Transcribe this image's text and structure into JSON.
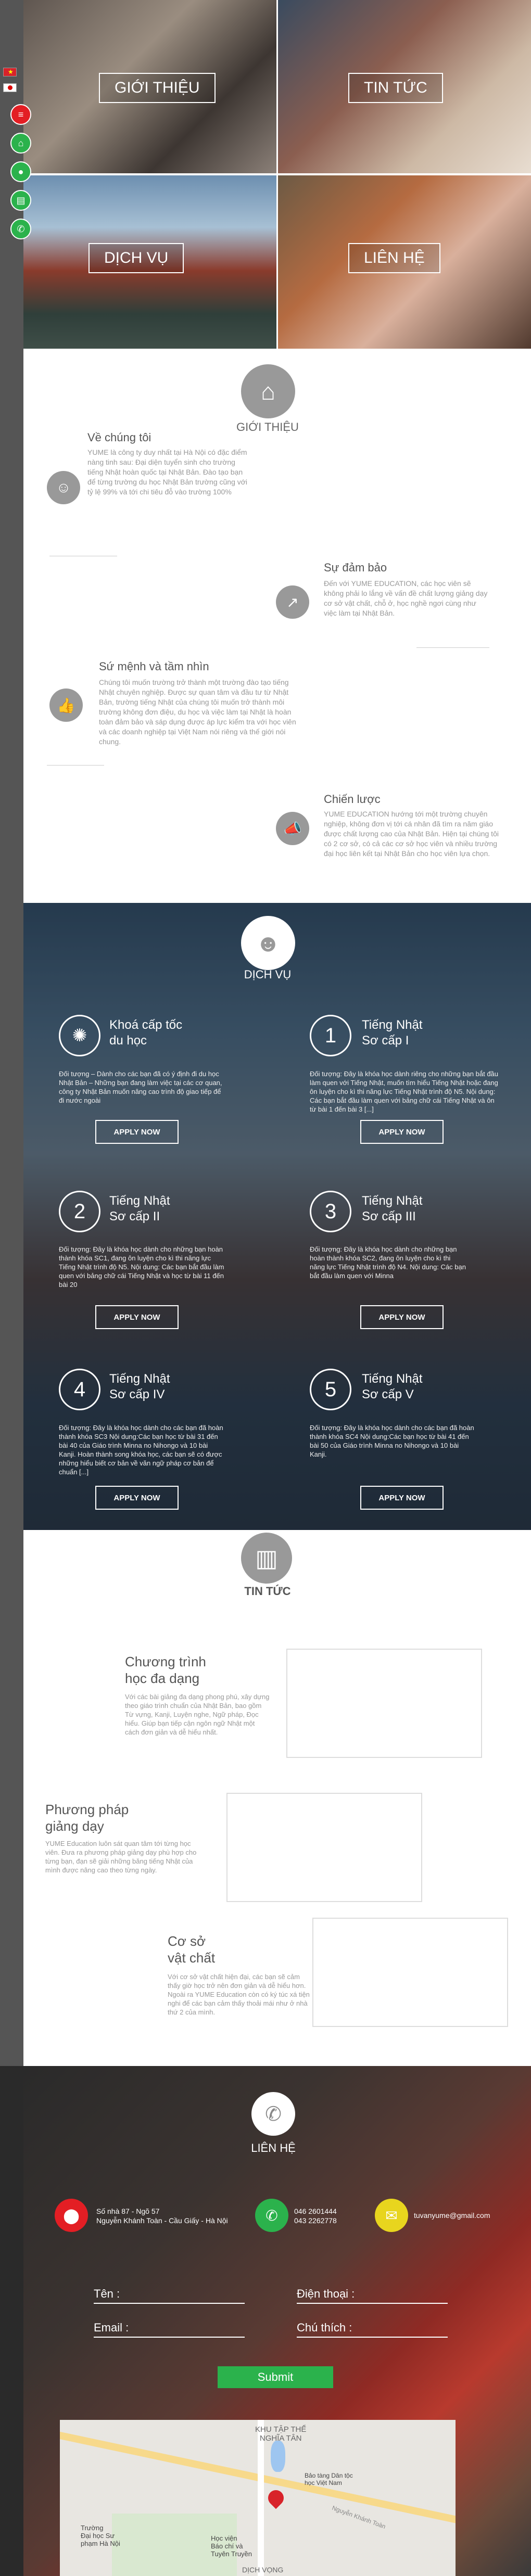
{
  "side": {
    "icons": [
      "menu-icon",
      "home-icon",
      "user-icon",
      "document-icon",
      "phone-icon"
    ]
  },
  "hero": {
    "tiles": [
      "GIỚI THIỆU",
      "TIN TỨC",
      "DỊCH VỤ",
      "LIÊN HỆ"
    ]
  },
  "about": {
    "title": "GIỚI THIỆU",
    "items": [
      {
        "title": "Về chúng tôi",
        "text": "YUME là công ty duy nhất tại Hà Nội có đặc điểm nàng tinh sau: Đại diện tuyển sinh cho trường tiếng Nhật hoàn quốc tại Nhật Bản. Đào tạo bạn để từng trường du học Nhật Bản trường cũng với tỷ lệ 99% và tới chi tiêu đỗ vào trường 100%"
      },
      {
        "title": "Sự đảm bảo",
        "text": "Đến với YUME EDUCATION, các học viên sẽ không phải lo lắng về vấn đề chất lượng giảng dạy cơ sở vật chất, chỗ ở, học nghề ngơi cùng như việc làm tại Nhật Bản."
      },
      {
        "title": "Sứ mệnh và tầm nhìn",
        "text": "Chúng tôi muốn trường trở thành một trường đào tạo tiếng Nhật chuyên nghiệp. Được sự quan tâm và đầu tư từ Nhật Bản, trường tiếng Nhật của chúng tôi muốn trở thành môi trường không đơn điệu, du học và việc làm tại Nhật là hoàn toàn đảm bảo và sáp dụng được áp lực kiểm tra với học viên và các doanh nghiệp tại Việt Nam nói riêng và thế giới nói chung."
      },
      {
        "title": "Chiến lược",
        "text": "YUME EDUCATION hướng tới một trường chuyên nghiệp, không đơn vị tới cá nhân đã tìm ra năm giáo được chất lượng cao của Nhật Bản. Hiện tại chúng tôi có 2 cơ sở, có cả các cơ sở học viên và nhiều trường đại học liên kết tại Nhật Bản cho học viên lựa chọn."
      }
    ]
  },
  "services": {
    "title": "DỊCH VỤ",
    "apply_label": "APPLY NOW",
    "items": [
      {
        "mark": "✺",
        "title1": "Khoá cấp tốc",
        "title2": "du học",
        "text": "Đối tượng – Dành cho các bạn đã có ý định đi du học Nhật Bản – Những bạn đang làm việc tại các cơ quan, công ty Nhật Bản muốn nâng cao trình độ giao tiếp để đi nước ngoài"
      },
      {
        "mark": "1",
        "title1": "Tiếng Nhật",
        "title2": "Sơ cấp I",
        "text": "Đối tượng: Đây là khóa học dành riêng cho những bạn bắt đầu làm quen với Tiếng Nhật, muốn tìm hiểu Tiếng Nhật hoặc đang ôn luyện cho kì thi năng lực Tiếng Nhật trình độ N5. Nội dung: Các bạn bắt đầu làm quen với bảng chữ cái Tiếng Nhật và ôn từ bài 1 đến bài 3 [...]"
      },
      {
        "mark": "2",
        "title1": "Tiếng Nhật",
        "title2": "Sơ cấp II",
        "text": "Đối tượng: Đây là khóa học dành cho những bạn hoàn thành khóa SC1, đang ôn luyện cho kì thi năng lực Tiếng Nhật trình độ N5. Nội dung: Các bạn bắt đầu làm quen với bảng chữ cái Tiếng Nhật và học từ bài 11 đến bài 20"
      },
      {
        "mark": "3",
        "title1": "Tiếng Nhật",
        "title2": "Sơ cấp III",
        "text": "Đối tượng: Đây là khóa học dành cho những bạn hoàn thành khóa SC2, đang ôn luyện cho kì thi năng lực Tiếng Nhật trình độ N4. Nội dung: Các bạn bắt đầu làm quen với Minna"
      },
      {
        "mark": "4",
        "title1": "Tiếng Nhật",
        "title2": "Sơ cấp IV",
        "text": "Đối tượng: Đây là khóa học dành cho các bạn đã hoàn thành khóa SC3 Nội dung:Các bạn học từ bài 31 đến bài 40 của Giáo trình Minna no Nihongo và 10 bài Kanji. Hoàn thành song khóa học, các bạn sẽ có được những hiểu biết cơ bản về văn ngữ pháp cơ bản để chuẩn [...]"
      },
      {
        "mark": "5",
        "title1": "Tiếng Nhật",
        "title2": "Sơ cấp V",
        "text": "Đối tượng: Đây là khóa học dành cho các bạn đã hoàn thành khóa SC4 Nội dung:Các bạn học từ bài 41 đến bài 50 của Giáo trình Minna no Nihongo và 10 bài Kanji."
      }
    ]
  },
  "news": {
    "title": "TIN TỨC",
    "items": [
      {
        "title1": "Chương trình",
        "title2": "học đa dạng",
        "text": "Với các bài giảng đa dạng phong phú, xây dựng theo giáo trình chuẩn của Nhật Bản, bao gồm Từ vựng, Kanji, Luyện nghe, Ngữ pháp, Đọc hiểu. Giúp bạn tiếp cận ngôn ngữ Nhật một cách đơn giản và dễ hiểu nhất."
      },
      {
        "title1": "Phương pháp",
        "title2": "giảng dạy",
        "text": "YUME Education luôn sát quan tâm tới từng học viên. Đưa ra phương pháp giảng dạy phù hợp cho từng bạn, đạn sẽ giải những băng tiếng Nhật của mình được nâng cao theo từng ngày."
      },
      {
        "title1": "Cơ sở",
        "title2": "vật chất",
        "text": "Với cơ sở vật chất hiện đại, các bạn sẽ cảm thấy giờ học trở nên đơn giản và dễ hiểu hơn. Ngoài ra YUME Education còn có ký túc xá tiện nghi để các bạn cảm thấy thoải mái như ở nhà thứ 2 của mình."
      }
    ]
  },
  "contact": {
    "title": "LIÊN HỆ",
    "address": [
      "Số nhà 87 - Ngõ 57",
      "Nguyễn Khánh Toàn - Cầu Giấy - Hà Nội"
    ],
    "phones": [
      "046 2601444",
      "043 2262778"
    ],
    "email": "tuvanyume@gmail.com",
    "labels": {
      "name": "Tên :",
      "phone": "Điện thoại :",
      "email": "Email :",
      "note": "Chú thích :"
    },
    "submit": "Submit",
    "map_labels": [
      "KHU TẬP THỂ",
      "NGHĨA TÂN",
      "Bảo tàng Dân tộc",
      "học Việt Nam",
      "Trường",
      "Đại học Sư",
      "phạm Hà Nội",
      "Học viện",
      "Báo chí và",
      "Tuyên Truyền",
      "Nguyễn Khánh Toàn",
      "DỊCH VỌNG"
    ]
  }
}
